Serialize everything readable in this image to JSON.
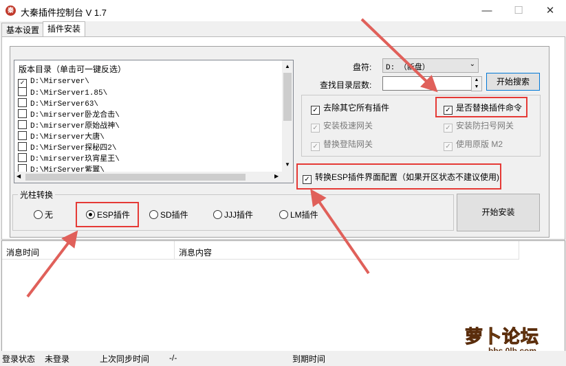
{
  "window": {
    "title": "大秦插件控制台 V 1.7",
    "icon_label": "秦",
    "minimize": "—",
    "maximize": "☐",
    "close": "✕"
  },
  "tabs": [
    {
      "label": "基本设置"
    },
    {
      "label": "插件安装"
    }
  ],
  "version_list": {
    "header": "版本目录（单击可一键反选）",
    "items": [
      {
        "path": "D:\\Mirserver\\",
        "checked": true
      },
      {
        "path": "D:\\MirServer1.85\\",
        "checked": false
      },
      {
        "path": "D:\\MirServer63\\",
        "checked": false
      },
      {
        "path": "D:\\mirserver卧龙合击\\",
        "checked": false
      },
      {
        "path": "D:\\mirserver原始战神\\",
        "checked": false
      },
      {
        "path": "D:\\Mirserver大唐\\",
        "checked": false
      },
      {
        "path": "D:\\MirServer探秘四2\\",
        "checked": false
      },
      {
        "path": "D:\\mirserver玖宵星王\\",
        "checked": false
      },
      {
        "path": "D:\\MirServer紫翼\\",
        "checked": false
      }
    ]
  },
  "drive": {
    "label": "盘符:",
    "value": "D: （新盘）"
  },
  "depth": {
    "label": "查找目录层数:",
    "value": ""
  },
  "search_button": "开始搜索",
  "options": {
    "remove_others": {
      "label": "去除其它所有插件",
      "checked": true
    },
    "replace_cmd": {
      "label": "是否替换插件命令",
      "checked": true
    },
    "install_fast_gate": {
      "label": "安装极速网关",
      "checked": true
    },
    "install_anti_scan": {
      "label": "安装防扫号网关",
      "checked": true
    },
    "replace_login_gate": {
      "label": "替换登陆网关",
      "checked": true
    },
    "use_original_m2": {
      "label": "使用原版 M2",
      "checked": true
    },
    "convert_esp": {
      "label": "转换ESP插件界面配置（如果开区状态不建议使用)",
      "checked": true
    }
  },
  "light_pillar": {
    "title": "光柱转换",
    "options": [
      {
        "label": "无",
        "selected": false
      },
      {
        "label": "ESP插件",
        "selected": true
      },
      {
        "label": "SD插件",
        "selected": false
      },
      {
        "label": "JJJ插件",
        "selected": false
      },
      {
        "label": "LM插件",
        "selected": false
      }
    ]
  },
  "install_button": "开始安装",
  "log_table": {
    "columns": [
      "消息时间",
      "消息内容"
    ]
  },
  "status": {
    "login_label": "登录状态",
    "login_value": "未登录",
    "sync_label": "上次同步时间",
    "sync_value": "-/-",
    "expire_label": "到期时间",
    "expire_value": ""
  },
  "watermark": {
    "text": "萝卜论坛",
    "url": "bbs.0lb.com"
  },
  "colors": {
    "highlight": "#e53935",
    "arrow": "#e0605a"
  }
}
